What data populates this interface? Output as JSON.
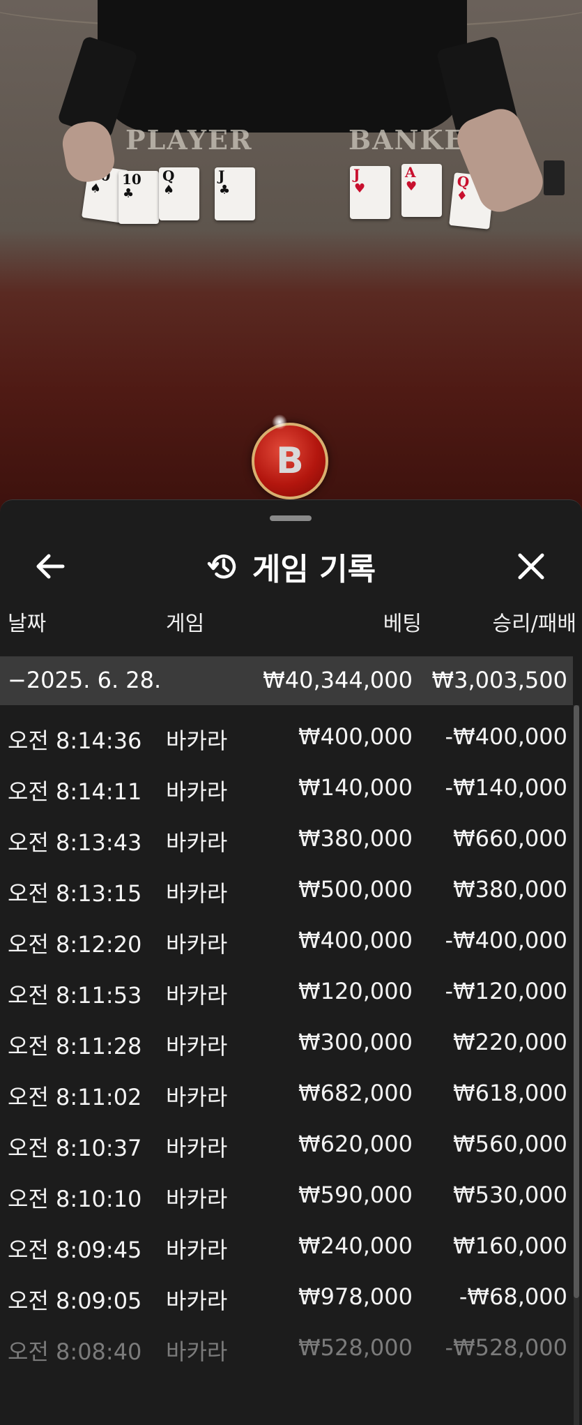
{
  "table": {
    "player_label": "PLAYER",
    "banker_label": "BANKER",
    "player_cards": [
      {
        "rank": "10",
        "suit": "♠",
        "color": "black"
      },
      {
        "rank": "10",
        "suit": "♣",
        "color": "black"
      },
      {
        "rank": "Q",
        "suit": "♠",
        "color": "black"
      },
      {
        "rank": "J",
        "suit": "♣",
        "color": "black"
      }
    ],
    "banker_cards": [
      {
        "rank": "J",
        "suit": "♥",
        "color": "red"
      },
      {
        "rank": "A",
        "suit": "♥",
        "color": "red"
      },
      {
        "rank": "Q",
        "suit": "♦",
        "color": "red"
      }
    ],
    "bet_chip_label": "B"
  },
  "sheet": {
    "title": "게임 기록",
    "icons": {
      "back": "arrow-left-icon",
      "history": "history-icon",
      "close": "close-icon"
    },
    "columns": {
      "date": "날짜",
      "game": "게임",
      "bet": "베팅",
      "result": "승리/패배"
    },
    "summary": {
      "date": "−2025. 6. 28.",
      "bet": "₩40,344,000",
      "result": "₩3,003,500"
    },
    "rows": [
      {
        "time": "오전 8:14:36",
        "game": "바카라",
        "bet": "₩400,000",
        "result": "-₩400,000"
      },
      {
        "time": "오전 8:14:11",
        "game": "바카라",
        "bet": "₩140,000",
        "result": "-₩140,000"
      },
      {
        "time": "오전 8:13:43",
        "game": "바카라",
        "bet": "₩380,000",
        "result": "₩660,000"
      },
      {
        "time": "오전 8:13:15",
        "game": "바카라",
        "bet": "₩500,000",
        "result": "₩380,000"
      },
      {
        "time": "오전 8:12:20",
        "game": "바카라",
        "bet": "₩400,000",
        "result": "-₩400,000"
      },
      {
        "time": "오전 8:11:53",
        "game": "바카라",
        "bet": "₩120,000",
        "result": "-₩120,000"
      },
      {
        "time": "오전 8:11:28",
        "game": "바카라",
        "bet": "₩300,000",
        "result": "₩220,000"
      },
      {
        "time": "오전 8:11:02",
        "game": "바카라",
        "bet": "₩682,000",
        "result": "₩618,000"
      },
      {
        "time": "오전 8:10:37",
        "game": "바카라",
        "bet": "₩620,000",
        "result": "₩560,000"
      },
      {
        "time": "오전 8:10:10",
        "game": "바카라",
        "bet": "₩590,000",
        "result": "₩530,000"
      },
      {
        "time": "오전 8:09:45",
        "game": "바카라",
        "bet": "₩240,000",
        "result": "₩160,000"
      },
      {
        "time": "오전 8:09:05",
        "game": "바카라",
        "bet": "₩978,000",
        "result": "-₩68,000"
      },
      {
        "time": "오전 8:08:40",
        "game": "바카라",
        "bet": "₩528,000",
        "result": "-₩528,000"
      }
    ]
  }
}
